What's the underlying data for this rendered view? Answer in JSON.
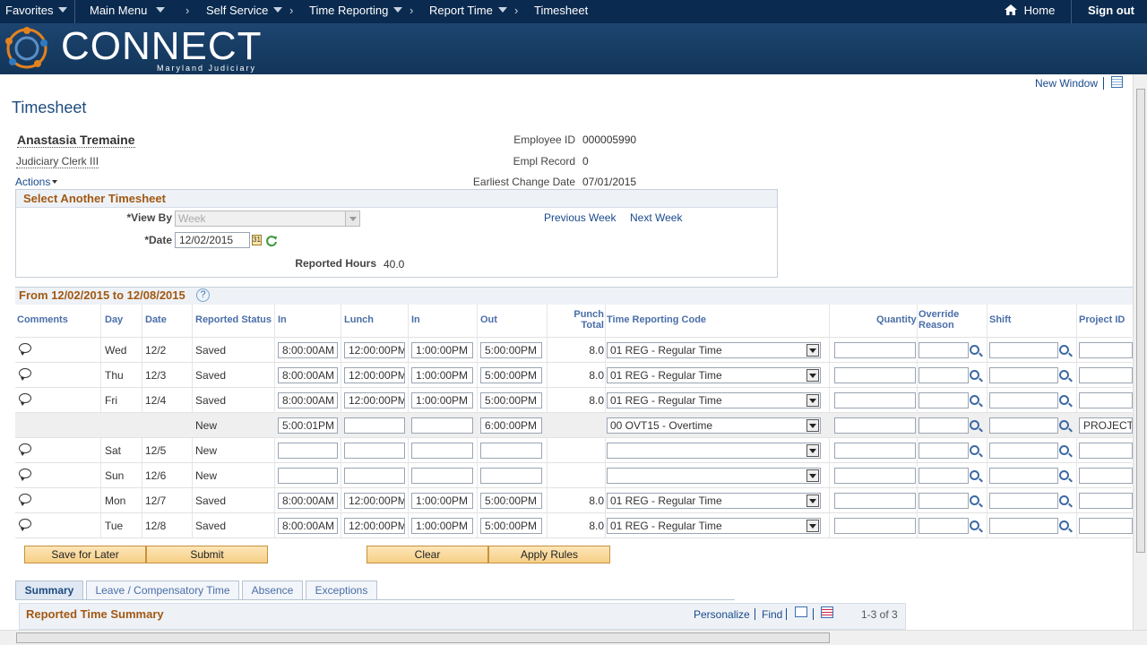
{
  "nav": {
    "favorites": "Favorites",
    "main_menu": "Main Menu",
    "self_service": "Self Service",
    "time_reporting": "Time Reporting",
    "report_time": "Report Time",
    "timesheet": "Timesheet",
    "home": "Home",
    "sign_out": "Sign out"
  },
  "banner": {
    "logo": "CONNECT",
    "subtitle": "Maryland Judiciary"
  },
  "toolbar": {
    "new_window": "New Window"
  },
  "page": {
    "title": "Timesheet"
  },
  "employee": {
    "name": "Anastasia Tremaine",
    "job_title": "Judiciary Clerk III",
    "employee_id_label": "Employee ID",
    "employee_id": "000005990",
    "empl_record_label": "Empl Record",
    "empl_record": "0",
    "earliest_change_label": "Earliest Change Date",
    "earliest_change": "07/01/2015",
    "actions": "Actions"
  },
  "select_timesheet": {
    "title": "Select Another Timesheet",
    "view_by_label": "*View By",
    "view_by": "Week",
    "date_label": "*Date",
    "date": "12/02/2015",
    "previous_week": "Previous Week",
    "next_week": "Next Week",
    "reported_hours_label": "Reported Hours",
    "reported_hours": "40.0"
  },
  "period": {
    "title": "From 12/02/2015 to 12/08/2015"
  },
  "columns": {
    "comments": "Comments",
    "day": "Day",
    "date": "Date",
    "status": "Reported Status",
    "in": "In",
    "lunch": "Lunch",
    "in2": "In",
    "out": "Out",
    "punch_total": "Punch Total",
    "trc": "Time Reporting Code",
    "quantity": "Quantity",
    "override": "Override Reason",
    "shift": "Shift",
    "project": "Project ID"
  },
  "rows": [
    {
      "day": "Wed",
      "date": "12/2",
      "status": "Saved",
      "in": "8:00:00AM",
      "lunch": "12:00:00PM",
      "in2": "1:00:00PM",
      "out": "5:00:00PM",
      "total": "8.0",
      "trc": "01 REG - Regular Time",
      "project": ""
    },
    {
      "day": "Thu",
      "date": "12/3",
      "status": "Saved",
      "in": "8:00:00AM",
      "lunch": "12:00:00PM",
      "in2": "1:00:00PM",
      "out": "5:00:00PM",
      "total": "8.0",
      "trc": "01 REG - Regular Time",
      "project": ""
    },
    {
      "day": "Fri",
      "date": "12/4",
      "status": "Saved",
      "in": "8:00:00AM",
      "lunch": "12:00:00PM",
      "in2": "1:00:00PM",
      "out": "5:00:00PM",
      "total": "8.0",
      "trc": "01 REG - Regular Time",
      "project": ""
    },
    {
      "day": "",
      "date": "",
      "status": "New",
      "in": "5:00:01PM",
      "lunch": "",
      "in2": "",
      "out": "6:00:00PM",
      "total": "",
      "trc": "00 OVT15 - Overtime",
      "project": "PROJECTS"
    },
    {
      "day": "Sat",
      "date": "12/5",
      "status": "New",
      "in": "",
      "lunch": "",
      "in2": "",
      "out": "",
      "total": "",
      "trc": "",
      "project": ""
    },
    {
      "day": "Sun",
      "date": "12/6",
      "status": "New",
      "in": "",
      "lunch": "",
      "in2": "",
      "out": "",
      "total": "",
      "trc": "",
      "project": ""
    },
    {
      "day": "Mon",
      "date": "12/7",
      "status": "Saved",
      "in": "8:00:00AM",
      "lunch": "12:00:00PM",
      "in2": "1:00:00PM",
      "out": "5:00:00PM",
      "total": "8.0",
      "trc": "01 REG - Regular Time",
      "project": ""
    },
    {
      "day": "Tue",
      "date": "12/8",
      "status": "Saved",
      "in": "8:00:00AM",
      "lunch": "12:00:00PM",
      "in2": "1:00:00PM",
      "out": "5:00:00PM",
      "total": "8.0",
      "trc": "01 REG - Regular Time",
      "project": ""
    }
  ],
  "buttons": {
    "save": "Save for Later",
    "submit": "Submit",
    "clear": "Clear",
    "apply": "Apply Rules"
  },
  "tabs": [
    "Summary",
    "Leave / Compensatory Time",
    "Absence",
    "Exceptions"
  ],
  "summary": {
    "title": "Reported Time Summary",
    "personalize": "Personalize",
    "find": "Find",
    "paging": "1-3 of 3"
  },
  "colors": {
    "nav_bg": "#0a2a4f",
    "section_title": "#a25812",
    "link": "#1a4a8c",
    "button": "#f6cf86"
  }
}
